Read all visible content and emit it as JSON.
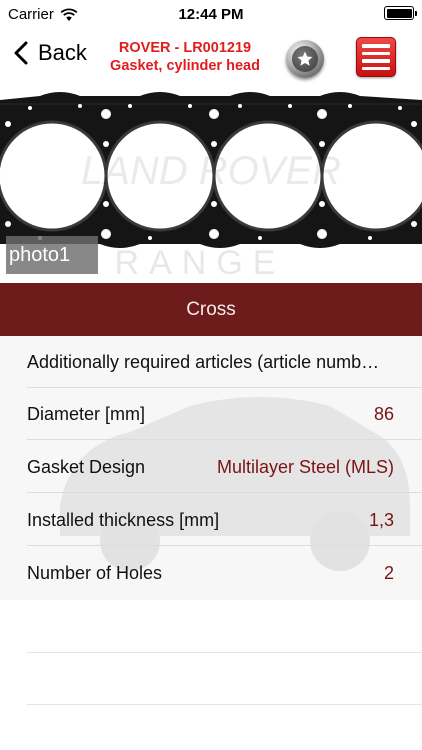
{
  "status_bar": {
    "carrier": "Carrier",
    "time": "12:44 PM",
    "battery_level": 1.0
  },
  "nav": {
    "back_label": "Back",
    "title_line1": "ROVER - LR001219",
    "title_line2": "Gasket, cylinder head",
    "favorite_icon": "star-icon",
    "menu_icon": "hamburger-menu-icon"
  },
  "photo": {
    "label": "photo1",
    "watermark_brand": "LAND ROVER",
    "watermark_model": "RANGE"
  },
  "cross_button": {
    "label": "Cross",
    "background": "#6e1b1b"
  },
  "details": [
    {
      "label": "Additionally required articles (article numb…",
      "value": ""
    },
    {
      "label": "Diameter [mm]",
      "value": "86"
    },
    {
      "label": "Gasket Design",
      "value": "Multilayer Steel (MLS)"
    },
    {
      "label": "Installed thickness [mm]",
      "value": "1,3"
    },
    {
      "label": "Number of Holes",
      "value": "2"
    }
  ],
  "colors": {
    "accent_red": "#e31c1c",
    "value_red": "#7a1414",
    "cross_bar": "#6e1b1b"
  }
}
